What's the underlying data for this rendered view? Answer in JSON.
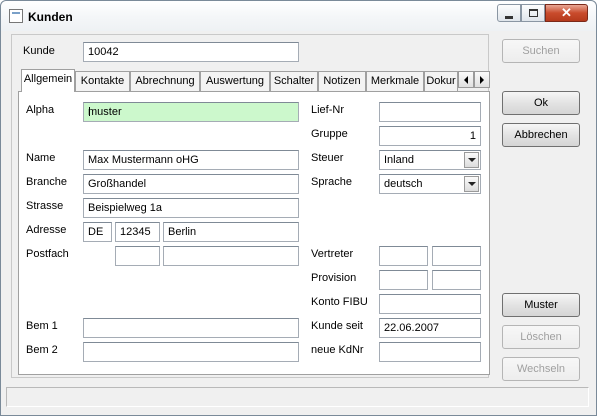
{
  "window": {
    "title": "Kunden"
  },
  "kunde": {
    "label": "Kunde",
    "value": "10042"
  },
  "tabs": [
    {
      "label": "Allgemein",
      "active": true
    },
    {
      "label": "Kontakte"
    },
    {
      "label": "Abrechnung"
    },
    {
      "label": "Auswertung"
    },
    {
      "label": "Schalter"
    },
    {
      "label": "Notizen"
    },
    {
      "label": "Merkmale"
    },
    {
      "label": "Dokur"
    }
  ],
  "left_fields": {
    "alpha": {
      "label": "Alpha",
      "value": "muster"
    },
    "name": {
      "label": "Name",
      "value": "Max Mustermann oHG"
    },
    "branche": {
      "label": "Branche",
      "value": "Großhandel"
    },
    "strasse": {
      "label": "Strasse",
      "value": "Beispielweg 1a"
    },
    "adresse": {
      "label": "Adresse",
      "country": "DE",
      "plz": "12345",
      "ort": "Berlin"
    },
    "postfach": {
      "label": "Postfach",
      "nummer": "",
      "plz": ""
    },
    "bem1": {
      "label": "Bem 1",
      "value": ""
    },
    "bem2": {
      "label": "Bem 2",
      "value": ""
    }
  },
  "right_fields": {
    "lief_nr": {
      "label": "Lief-Nr",
      "value": ""
    },
    "gruppe": {
      "label": "Gruppe",
      "value": "1"
    },
    "steuer": {
      "label": "Steuer",
      "value": "Inland"
    },
    "sprache": {
      "label": "Sprache",
      "value": "deutsch"
    },
    "vertreter": {
      "label": "Vertreter",
      "value1": "",
      "value2": ""
    },
    "provision": {
      "label": "Provision",
      "value1": "",
      "value2": ""
    },
    "konto_fibu": {
      "label": "Konto FIBU",
      "value": ""
    },
    "kunde_seit": {
      "label": "Kunde seit",
      "value": "22.06.2007"
    },
    "neue_kdnr": {
      "label": "neue KdNr",
      "value": ""
    }
  },
  "buttons": {
    "suchen": {
      "label": "Suchen",
      "enabled": false
    },
    "ok": {
      "label": "Ok",
      "enabled": true
    },
    "abbrechen": {
      "label": "Abbrechen",
      "enabled": true
    },
    "muster": {
      "label": "Muster",
      "enabled": true
    },
    "loeschen": {
      "label": "Löschen",
      "enabled": false
    },
    "wechseln": {
      "label": "Wechseln",
      "enabled": false
    }
  },
  "colors": {
    "alpha_field_bg": "#ccf8cc",
    "close_button": "#c94b2c"
  }
}
